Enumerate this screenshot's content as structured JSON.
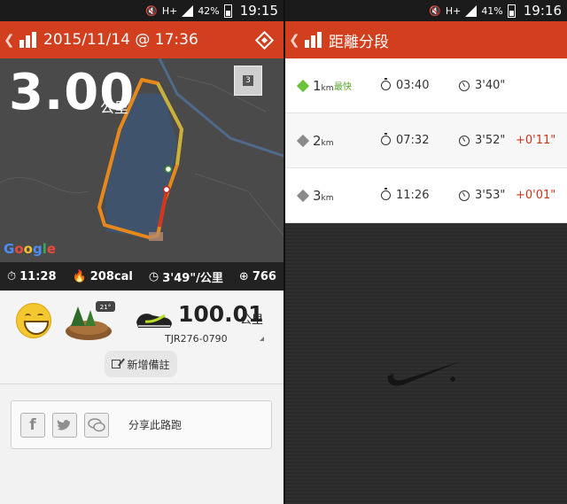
{
  "left": {
    "status": {
      "battery": "42%",
      "time": "19:15",
      "network": "H+"
    },
    "appbar": {
      "title": "2015/11/14 @ 17:36"
    },
    "run": {
      "distance": "3.00",
      "distance_unit": "公里",
      "lap_count": "3"
    },
    "map": {
      "attribution": "Google"
    },
    "stats": {
      "duration": "11:28",
      "calories": "208cal",
      "pace": "3'49\"/公里",
      "fuel": "766"
    },
    "gear": {
      "weather": "21°",
      "shoe_distance": "100.01",
      "shoe_unit": "公里",
      "shoe_model": "TJR276-0790"
    },
    "note_button": "新增備註",
    "share": {
      "label": "分享此路跑",
      "facebook_glyph": "f"
    }
  },
  "right": {
    "status": {
      "battery": "41%",
      "time": "19:16",
      "network": "H+"
    },
    "appbar": {
      "title": "距離分段"
    },
    "splits": [
      {
        "km": "1",
        "unit": "km",
        "tag": "最快",
        "time": "03:40",
        "pace": "3'40\"",
        "diff": ""
      },
      {
        "km": "2",
        "unit": "km",
        "tag": "",
        "time": "07:32",
        "pace": "3'52\"",
        "diff": "+0'11\""
      },
      {
        "km": "3",
        "unit": "km",
        "tag": "",
        "time": "11:26",
        "pace": "3'53\"",
        "diff": "+0'01\""
      }
    ]
  },
  "colors": {
    "accent": "#d23f1e",
    "best": "#6cc23a",
    "diff": "#c7361a",
    "route": "#f0a020"
  },
  "icons": [
    "back-icon",
    "chart-bars-icon",
    "diamond-icon",
    "stopwatch-icon",
    "flame-icon",
    "timer-icon",
    "fuel-icon",
    "smiley-icon",
    "terrain-icon",
    "shoe-icon",
    "edit-icon",
    "facebook-icon",
    "twitter-icon",
    "wechat-icon",
    "nike-plus-logo"
  ]
}
